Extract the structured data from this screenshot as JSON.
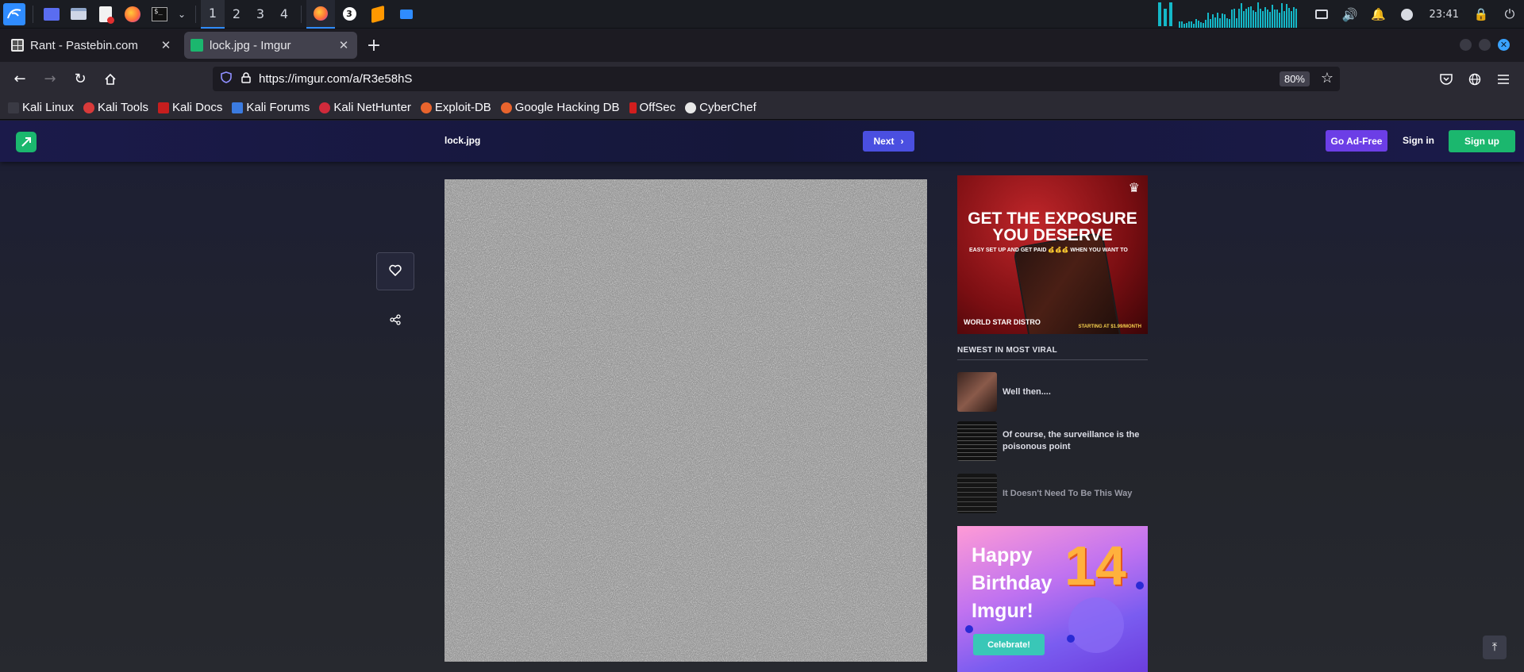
{
  "taskbar": {
    "workspaces": [
      "1",
      "2",
      "3",
      "4"
    ],
    "active_workspace": "1",
    "badge_count": "3",
    "clock": "23:41"
  },
  "browser": {
    "tabs": [
      {
        "title": "Rant - Pastebin.com",
        "active": false
      },
      {
        "title": "lock.jpg - Imgur",
        "active": true
      }
    ],
    "url": "https://imgur.com/a/R3e58hS",
    "zoom": "80%"
  },
  "bookmarks": [
    "Kali Linux",
    "Kali Tools",
    "Kali Docs",
    "Kali Forums",
    "Kali NetHunter",
    "Exploit-DB",
    "Google Hacking DB",
    "OffSec",
    "CyberChef"
  ],
  "imgur": {
    "post_title": "lock.jpg",
    "next_label": "Next",
    "go_ad_free": "Go Ad-Free",
    "sign_in": "Sign in",
    "sign_up": "Sign up",
    "ad1": {
      "headline_1": "GET THE EXPOSURE",
      "headline_2": "YOU DESERVE",
      "sub": "EASY SET UP AND GET PAID 💰💰💰 WHEN YOU WANT TO",
      "brand": "WORLD STAR  DISTRO",
      "price": "STARTING AT $1.99/MONTH"
    },
    "newest_heading": "NEWEST IN MOST VIRAL",
    "viral_posts": [
      {
        "title": "Well then...."
      },
      {
        "title": "Of course, the surveillance is the poisonous point"
      },
      {
        "title": "It Doesn't Need To Be This Way"
      }
    ],
    "ad2": {
      "line1": "Happy",
      "line2": "Birthday",
      "line3": "Imgur!",
      "number": "14",
      "button": "Celebrate!"
    }
  },
  "colors": {
    "accent_blue": "#2f8cff",
    "imgur_green": "#1bb76e",
    "next_blue": "#4a4fe0",
    "adfree_purple": "#6c3ee6"
  }
}
